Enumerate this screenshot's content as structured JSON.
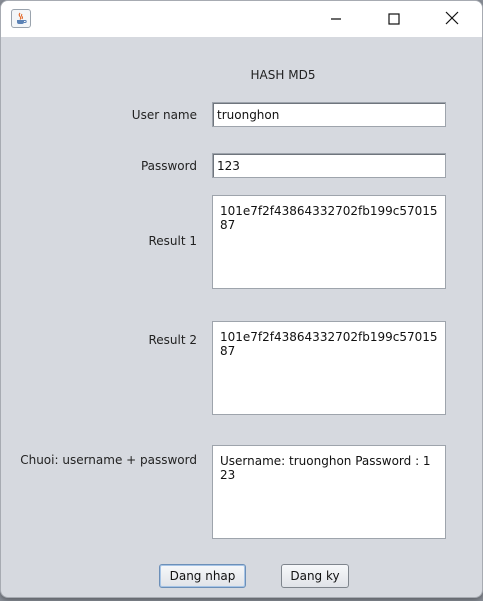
{
  "window": {
    "controls": {
      "minimize_icon": "minimize-icon",
      "maximize_icon": "maximize-icon",
      "close_icon": "close-icon"
    }
  },
  "form": {
    "heading": "HASH MD5",
    "username_label": "User name",
    "username_value": "truonghon",
    "password_label": "Password",
    "password_value": "123",
    "result1_label": "Result 1",
    "result1_value": "101e7f2f43864332702fb199c5701587",
    "result2_label": "Result 2",
    "result2_value": "101e7f2f43864332702fb199c5701587",
    "concat_label": "Chuoi: username + password",
    "concat_value": "Username: truonghon Password : 123"
  },
  "buttons": {
    "login_label": "Dang nhap",
    "register_label": "Dang ky"
  },
  "colors": {
    "window_bg": "#d6d9df",
    "titlebar_bg": "#ffffff"
  }
}
